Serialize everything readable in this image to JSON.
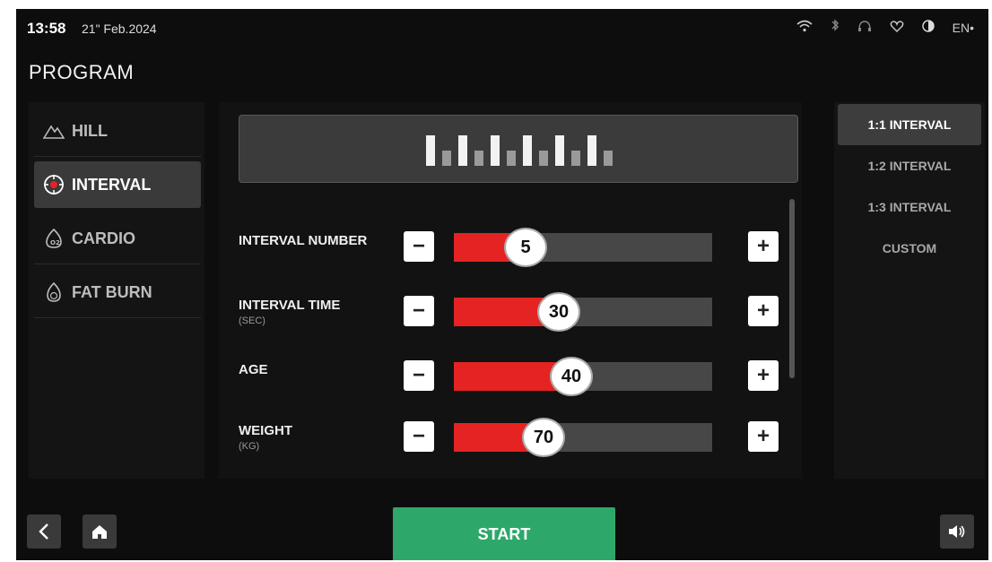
{
  "status": {
    "time": "13:58",
    "date": "21\" Feb.2024",
    "language": "EN•",
    "icons": [
      "wifi-icon",
      "bluetooth-icon",
      "headphones-icon",
      "heart-icon",
      "contrast-icon"
    ]
  },
  "page_title": "PROGRAM",
  "menu": {
    "items": [
      {
        "label": "HILL",
        "icon": "mountain-icon"
      },
      {
        "label": "INTERVAL",
        "icon": "target-icon"
      },
      {
        "label": "CARDIO",
        "icon": "lungs-icon"
      },
      {
        "label": "FAT BURN",
        "icon": "flame-icon"
      }
    ],
    "active_index": 1
  },
  "settings": [
    {
      "label": "INTERVAL NUMBER",
      "unit": "",
      "value": "5",
      "fraction": 0.2
    },
    {
      "label": "INTERVAL TIME",
      "unit": "(SEC)",
      "value": "30",
      "fraction": 0.33
    },
    {
      "label": "AGE",
      "unit": "",
      "value": "40",
      "fraction": 0.38
    },
    {
      "label": "WEIGHT",
      "unit": "(KG)",
      "value": "70",
      "fraction": 0.27
    }
  ],
  "minus_symbol": "−",
  "plus_symbol": "+",
  "preview_bars": [
    1,
    0.5,
    1,
    0.5,
    1,
    0.5,
    1,
    0.5,
    1,
    0.5,
    1,
    0.5
  ],
  "interval_options": {
    "items": [
      "1:1 INTERVAL",
      "1:2 INTERVAL",
      "1:3 INTERVAL",
      "CUSTOM"
    ],
    "active_index": 0
  },
  "bottom": {
    "start_label": "START",
    "icons": [
      "back-icon",
      "home-icon",
      "volume-icon"
    ]
  },
  "colors": {
    "accent_red": "#e52323",
    "start_green": "#2ea86a",
    "background": "#0d0d0d"
  }
}
